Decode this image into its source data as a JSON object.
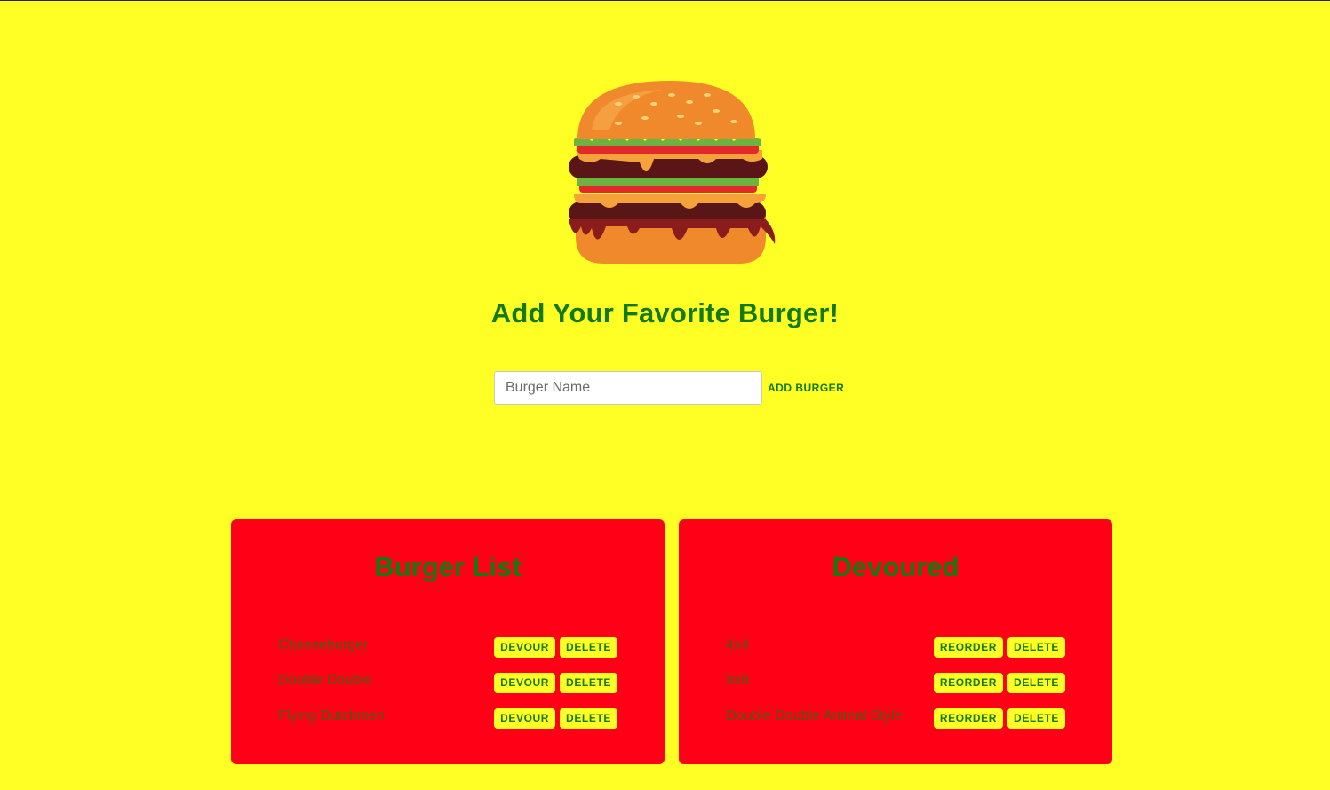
{
  "header": {
    "logo_icon": "burger-icon",
    "title": "Add Your Favorite Burger!"
  },
  "form": {
    "placeholder": "Burger Name",
    "value": "",
    "add_label": "ADD BURGER"
  },
  "burger_list": {
    "title": "Burger List",
    "items": [
      {
        "name": "Cheeseburger",
        "action": "DEVOUR",
        "delete": "DELETE"
      },
      {
        "name": "Double Double",
        "action": "DEVOUR",
        "delete": "DELETE"
      },
      {
        "name": "Flying Dutchmen",
        "action": "DEVOUR",
        "delete": "DELETE"
      }
    ]
  },
  "devoured": {
    "title": "Devoured",
    "items": [
      {
        "name": "4x4",
        "action": "REORDER",
        "delete": "DELETE"
      },
      {
        "name": "8x8",
        "action": "REORDER",
        "delete": "DELETE"
      },
      {
        "name": "Double Double Animal Style",
        "action": "REORDER",
        "delete": "DELETE"
      }
    ]
  },
  "colors": {
    "background": "#ffff25",
    "panel": "#ff0017",
    "heading": "#137a10"
  }
}
